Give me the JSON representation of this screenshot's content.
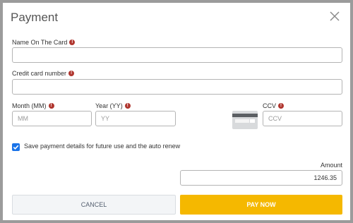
{
  "dialog": {
    "title": "Payment",
    "close_icon": "close-icon"
  },
  "form": {
    "name_on_card": {
      "label": "Name On The Card",
      "value": ""
    },
    "card_number": {
      "label": "Credit card number",
      "value": ""
    },
    "month": {
      "label": "Month (MM)",
      "placeholder": "MM"
    },
    "year": {
      "label": "Year (YY)",
      "placeholder": "YY"
    },
    "ccv": {
      "label": "CCV",
      "placeholder": "CCV"
    },
    "required_icon": "exclamation-icon",
    "card_icon": "credit-card-back-icon",
    "save_details": {
      "label": "Save payment details for future use and the auto renew",
      "checked": true
    },
    "amount": {
      "label": "Amount",
      "value": "1246.35"
    }
  },
  "buttons": {
    "cancel": "CANCEL",
    "pay": "PAY NOW"
  },
  "colors": {
    "primary": "#f5b800",
    "checkbox": "#1a73e8",
    "required": "#b0362f"
  }
}
